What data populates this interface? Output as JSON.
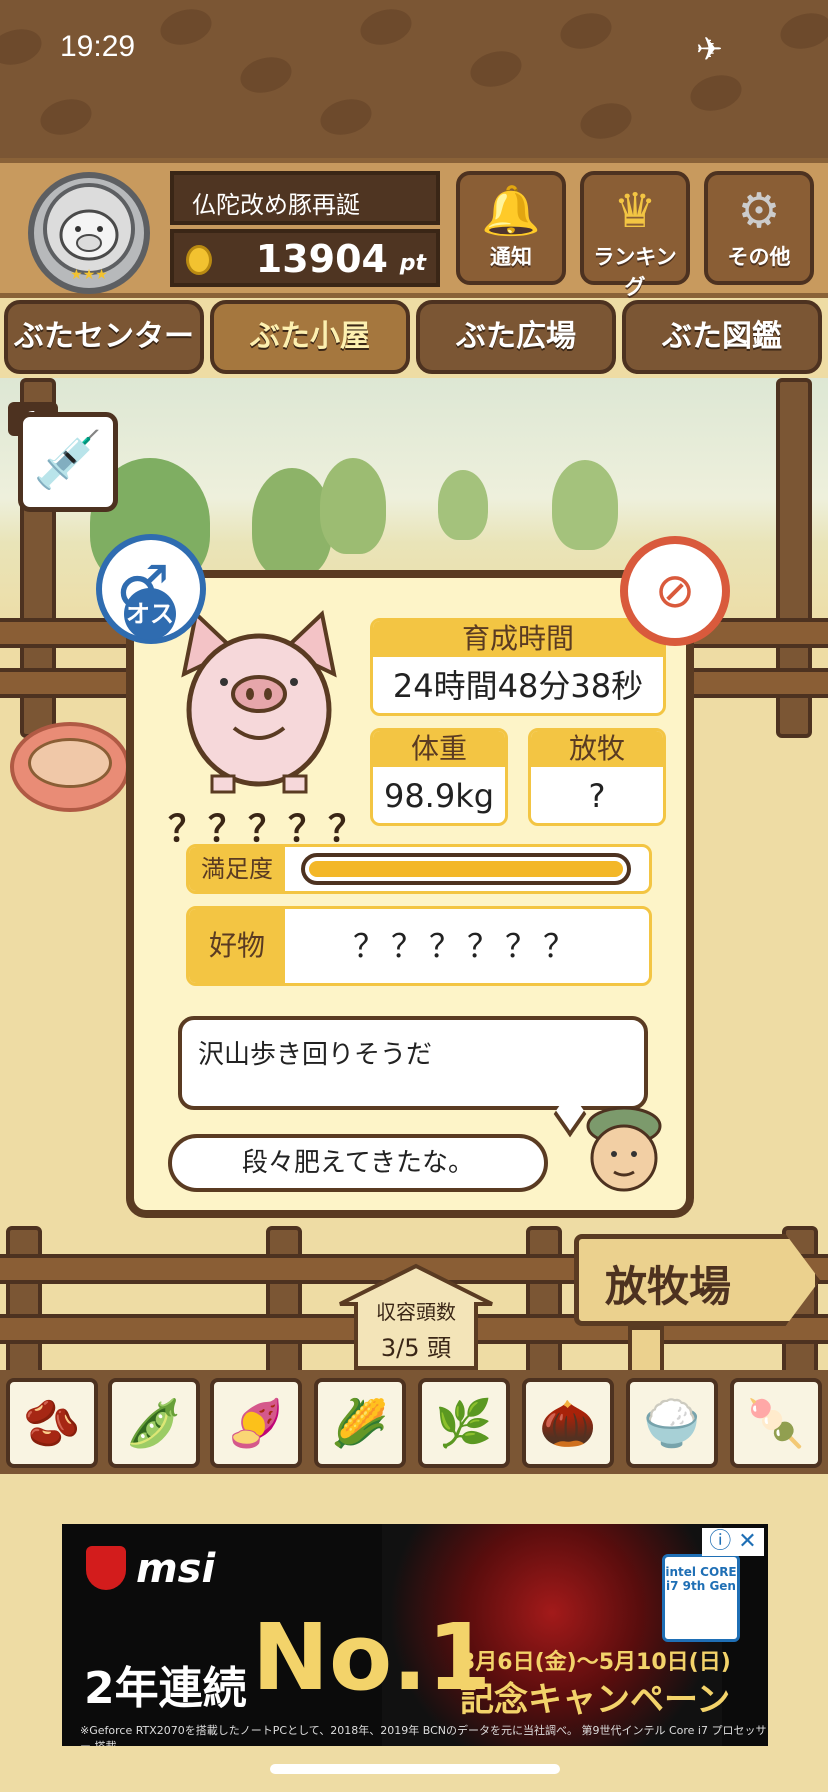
{
  "status_bar": {
    "time": "19:29",
    "airplane_icon": "airplane-icon"
  },
  "header": {
    "player_name": "仏陀改め豚再誕",
    "points": "13904",
    "points_unit": "pt",
    "buttons": [
      {
        "label": "通知",
        "icon": "bell-icon"
      },
      {
        "label": "ランキング",
        "icon": "crown-icon"
      },
      {
        "label": "その他",
        "icon": "gear-icon"
      }
    ]
  },
  "tabs": [
    {
      "label": "ぶたセンター",
      "active": false
    },
    {
      "label": "ぶた小屋",
      "active": true
    },
    {
      "label": "ぶた広場",
      "active": false
    },
    {
      "label": "ぶた図鑑",
      "active": false
    }
  ],
  "syringe": {
    "count": "1"
  },
  "pig": {
    "gender": "オス",
    "name": "？？？？？",
    "raising_time_label": "育成時間",
    "raising_time_value": "24時間48分38秒",
    "weight_label": "体重",
    "weight_value": "98.9kg",
    "grazing_label": "放牧",
    "grazing_value": "?",
    "satisfaction_label": "満足度",
    "satisfaction_level": 1.0,
    "favorite_label": "好物",
    "favorite_value": "？？？？？？"
  },
  "dialogue": {
    "pig_message": "沢山歩き回りそうだ",
    "farmer_message": "段々肥えてきたな。"
  },
  "capacity": {
    "label": "収容頭数",
    "value": "3/5 頭"
  },
  "pasture_sign": "放牧場",
  "foods": [
    "soybeans-icon",
    "mixed-beans-icon",
    "sweet-potato-icon",
    "corn-icon",
    "herb-berries-icon",
    "acorn-icon",
    "grain-plate-icon",
    "meatball-plate-icon"
  ],
  "ad": {
    "brand": "msi",
    "years": "2年連続",
    "rank": "No.1",
    "date": "3月6日(金)～5月10日(日)",
    "campaign": "記念キャンペーン",
    "intel": "intel CORE i7 9th Gen",
    "fine_print": "※Geforce RTX2070を搭載したノートPCとして、2018年、2019年 BCNのデータを元に当社調べ。 第9世代インテル Core i7 プロセッサー 搭載"
  }
}
